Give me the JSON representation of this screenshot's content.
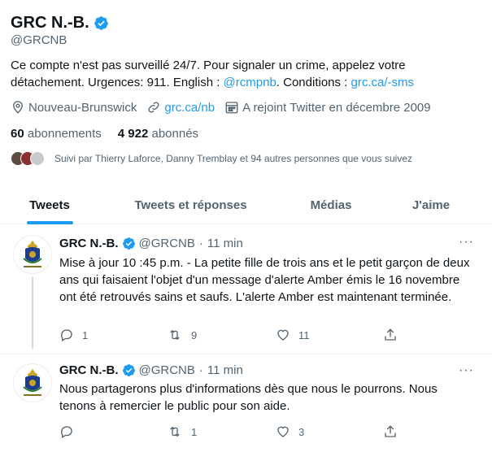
{
  "profile": {
    "name": "GRC N.-B.",
    "handle": "@GRCNB",
    "bio_prefix": "Ce compte n'est pas surveillé 24/7. Pour signaler un crime, appelez votre détachement. Urgences: 911. English : ",
    "bio_link1": "@rcmpnb",
    "bio_mid": ". Conditions : ",
    "bio_link2": "grc.ca/-sms",
    "location": "Nouveau-Brunswick",
    "website": "grc.ca/nb",
    "joined": "A rejoint Twitter en décembre 2009",
    "following_count": "60",
    "following_label": "abonnements",
    "followers_count": "4 922",
    "followers_label": "abonnés",
    "followed_by": "Suivi par Thierry Laforce, Danny Tremblay et 94 autres personnes que vous suivez"
  },
  "tabs": [
    {
      "label": "Tweets",
      "active": true
    },
    {
      "label": "Tweets et réponses",
      "active": false
    },
    {
      "label": "Médias",
      "active": false
    },
    {
      "label": "J'aime",
      "active": false
    }
  ],
  "tweets": [
    {
      "name": "GRC N.-B.",
      "handle": "@GRCNB",
      "dot": "·",
      "time": "11 min",
      "text": "Mise à jour 10 :45 p.m. - La petite fille de trois ans et le petit garçon de deux ans qui faisaient l'objet d'un message d'alerte Amber émis le 16 novembre ont été retrouvés sains et saufs. L'alerte Amber est maintenant terminée.",
      "replies": "1",
      "retweets": "9",
      "likes": "11"
    },
    {
      "name": "GRC N.-B.",
      "handle": "@GRCNB",
      "dot": "·",
      "time": "11 min",
      "text": "Nous partagerons plus d'informations dès que nous le pourrons. Nous tenons à remercier le public pour son aide.",
      "replies": "",
      "retweets": "1",
      "likes": "3"
    }
  ],
  "colors": {
    "accent": "#1d9bf0",
    "text": "#0f1419",
    "secondary": "#536471"
  },
  "icons": {
    "more": "···"
  }
}
